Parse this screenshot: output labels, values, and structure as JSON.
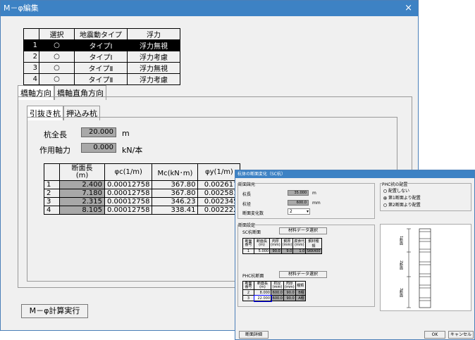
{
  "main_window": {
    "title": "M－φ編集",
    "close": "×",
    "case_table": {
      "headers": [
        "",
        "選択",
        "地震動タイプ",
        "浮力"
      ],
      "rows": [
        {
          "no": "1",
          "select": "○",
          "type": "タイプⅠ",
          "buoyancy": "浮力無視"
        },
        {
          "no": "2",
          "select": "○",
          "type": "タイプⅠ",
          "buoyancy": "浮力考慮"
        },
        {
          "no": "3",
          "select": "○",
          "type": "タイプⅡ",
          "buoyancy": "浮力無視"
        },
        {
          "no": "4",
          "select": "○",
          "type": "タイプⅡ",
          "buoyancy": "浮力考慮"
        }
      ]
    },
    "tabs": [
      "橋軸方向",
      "橋軸直角方向"
    ],
    "subtabs": [
      "引抜き杭",
      "押込み杭"
    ],
    "pile_length_label": "杭全長",
    "pile_length_value": "20.000",
    "pile_length_unit": "m",
    "axial_label": "作用軸力",
    "axial_value": "0.000",
    "axial_unit": "kN/本",
    "data_table": {
      "headers": [
        "",
        "断面長\n(m)",
        "φc(1/m)",
        "Mc(kN･m)",
        "φy(1/m)"
      ],
      "rows": [
        {
          "no": "1",
          "len": "2.400",
          "phic": "0.00012758",
          "mc": "367.80",
          "phiy": "0.002617"
        },
        {
          "no": "2",
          "len": "7.180",
          "phic": "0.00012758",
          "mc": "367.80",
          "phiy": "0.002581"
        },
        {
          "no": "3",
          "len": "2.315",
          "phic": "0.00012758",
          "mc": "346.23",
          "phiy": "0.002345"
        },
        {
          "no": "4",
          "len": "8.105",
          "phic": "0.00012758",
          "mc": "338.41",
          "phiy": "0.002222"
        }
      ]
    },
    "calc_button": "M－φ計算実行"
  },
  "sub_window": {
    "title": "杭体の断面変化（SC杭）",
    "section_specs_label": "断面諸元",
    "pile_length_label": "杭長",
    "pile_length_value": "35.000",
    "pile_length_unit": "m",
    "pile_dia_label": "杭径",
    "pile_dia_value": "600.0",
    "pile_dia_unit": "mm",
    "section_change_label": "断面変化数",
    "section_change_value": "2",
    "phc_group_label": "PHC杭の配置",
    "phc_options": [
      "配置しない",
      "第1断面より配置",
      "第2断面より配置"
    ],
    "section_settings_label": "断面設定",
    "sc_section_label": "SC杭断面",
    "sc_material_button": "材料データ選択",
    "sc_table": {
      "headers": [
        "断面\n番号",
        "断面長\n(m)",
        "肉厚\n(mm)",
        "鋼厚\n(mm)",
        "腐食代\n(mm)",
        "鋼材種類"
      ],
      "rows": [
        [
          "1",
          "5.000",
          "90.0",
          "9.0",
          "1.0",
          "SKK400"
        ]
      ]
    },
    "phc_section_label": "PHC杭断面",
    "phc_material_button": "材料データ選択",
    "phc_table": {
      "headers": [
        "断面\n番号",
        "断面長\n(m)",
        "杭径\n(mm)",
        "肉厚\n(mm)",
        "種類"
      ],
      "rows": [
        [
          "2",
          "8.000",
          "600.0",
          "90.0",
          "B種"
        ],
        [
          "3",
          "22.000",
          "600.0",
          "90.0",
          "A種"
        ]
      ]
    },
    "diagram_labels": [
      "1断面",
      "2断面",
      "3断面"
    ],
    "detail_button": "断面詳細",
    "ok_button": "OK",
    "cancel_button": "キャンセル"
  }
}
